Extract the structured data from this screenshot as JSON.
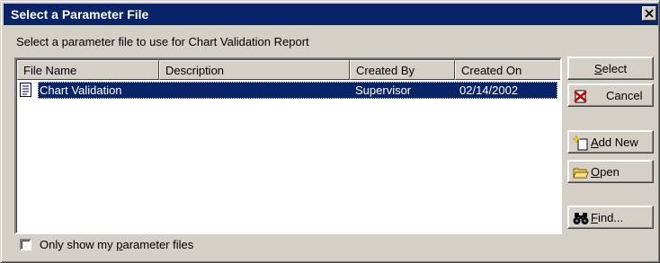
{
  "window": {
    "title": "Select a Parameter File",
    "instruction": "Select a parameter file to use for Chart Validation Report"
  },
  "list": {
    "columns": [
      "File Name",
      "Description",
      "Created By",
      "Created On"
    ],
    "rows": [
      {
        "file_name": "Chart Validation",
        "description": "",
        "created_by": "Supervisor",
        "created_on": "02/14/2002",
        "selected": true,
        "icon": "document-icon"
      }
    ]
  },
  "buttons": {
    "select": {
      "pre": "",
      "key": "S",
      "post": "elect"
    },
    "cancel": {
      "label": "Cancel",
      "icon": "cancel-icon"
    },
    "add_new": {
      "pre": "",
      "key": "A",
      "post": "dd New",
      "icon": "new-file-sparkle-icon"
    },
    "open": {
      "pre": "",
      "key": "O",
      "post": "pen",
      "icon": "open-folder-icon"
    },
    "find": {
      "pre": "",
      "key": "F",
      "post": "ind...",
      "icon": "binoculars-icon"
    }
  },
  "checkbox": {
    "pre": "Only show my ",
    "key": "p",
    "post": "arameter files",
    "checked": false
  },
  "colors": {
    "title_bar": "#0a246a",
    "face": "#d4d0c8",
    "selection": "#0a246a"
  }
}
